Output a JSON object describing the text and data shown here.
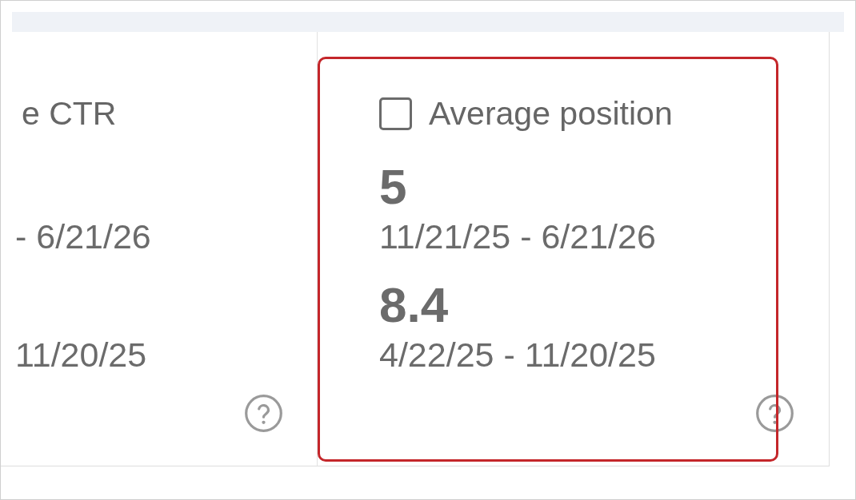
{
  "metrics": [
    {
      "label": "e CTR",
      "ranges": [
        {
          "dates": "- 6/21/26"
        },
        {
          "dates": "11/20/25"
        }
      ]
    },
    {
      "label": "Average position",
      "checked": false,
      "highlighted": true,
      "ranges": [
        {
          "value": "5",
          "dates": "11/21/25 - 6/21/26"
        },
        {
          "value": "8.4",
          "dates": "4/22/25 - 11/20/25"
        }
      ]
    }
  ]
}
